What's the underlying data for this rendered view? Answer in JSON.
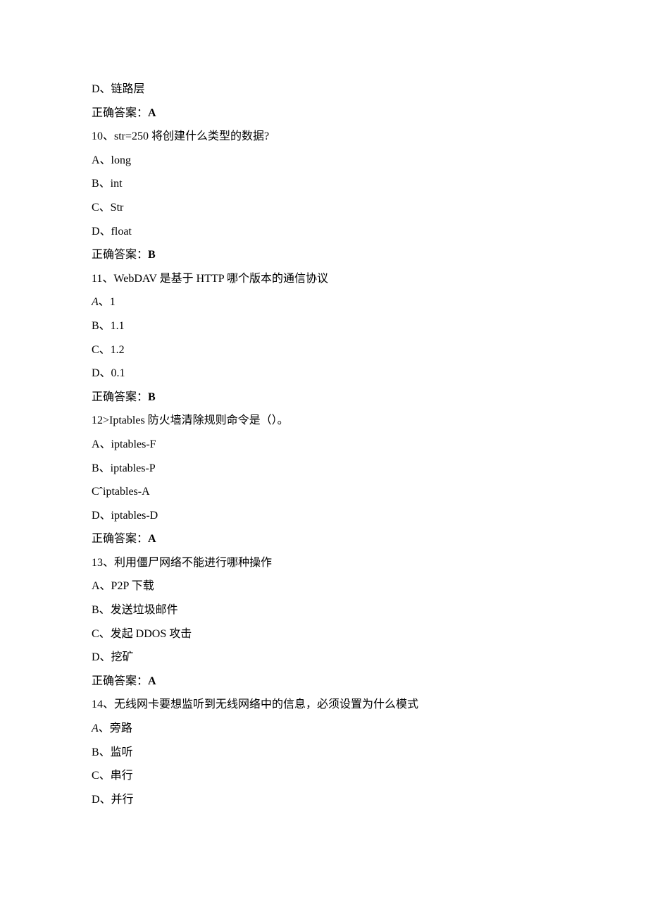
{
  "lines": [
    {
      "text": "D、链路层"
    },
    {
      "prefix": "正确答案：",
      "bold": "A"
    },
    {
      "text": "10、str=250 将创建什么类型的数据?"
    },
    {
      "text": "A、long"
    },
    {
      "text": "B、int"
    },
    {
      "text": "C、Str"
    },
    {
      "text": "D、float"
    },
    {
      "prefix": "正确答案：",
      "bold": "B"
    },
    {
      "text": "11、WebDAV 是基于 HTTP 哪个版本的通信协议"
    },
    {
      "italicPrefix": "A",
      "suffix": "、1"
    },
    {
      "text": "B、1.1"
    },
    {
      "text": "C、1.2"
    },
    {
      "text": "D、0.1"
    },
    {
      "prefix": "正确答案：",
      "bold": "B"
    },
    {
      "text": "12>Iptables 防火墙清除规则命令是（）。"
    },
    {
      "text": "A、iptables-F"
    },
    {
      "text": "B、iptables-P"
    },
    {
      "text": "Cˆiptables-A"
    },
    {
      "text": "D、iptables-D"
    },
    {
      "prefix": "正确答案：",
      "bold": "A"
    },
    {
      "text": "13、利用僵尸网络不能进行哪种操作"
    },
    {
      "text": "A、P2P 下载"
    },
    {
      "text": "B、发送垃圾邮件"
    },
    {
      "text": "C、发起 DDOS 攻击"
    },
    {
      "text": "D、挖矿"
    },
    {
      "prefix": "正确答案：",
      "bold": "A"
    },
    {
      "text": "14、无线网卡要想监听到无线网络中的信息，必须设置为什么模式"
    },
    {
      "italicPrefix": "A",
      "suffix": "、旁路"
    },
    {
      "text": "B、监听"
    },
    {
      "text": "C、串行"
    },
    {
      "text": "D、并行"
    }
  ]
}
